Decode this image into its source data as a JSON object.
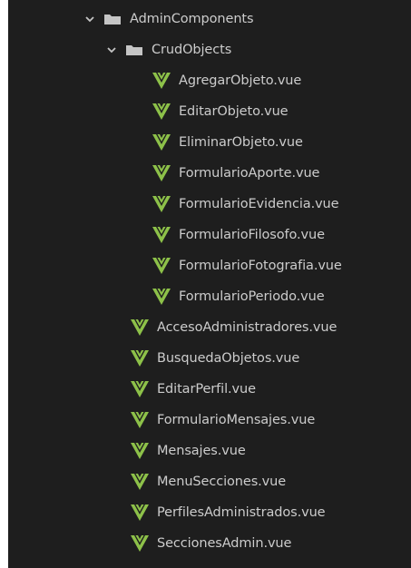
{
  "colors": {
    "background": "#1e1e1e",
    "text": "#cccccc",
    "folder": "#c5c5c5",
    "vue_logo": "#8dc149",
    "chevron": "#c5c5c5"
  },
  "tree": {
    "admin_components": {
      "label": "AdminComponents",
      "icon": "folder-icon",
      "expanded": true,
      "crud_objects": {
        "label": "CrudObjects",
        "icon": "folder-icon",
        "expanded": true,
        "files": [
          {
            "label": "AgregarObjeto.vue",
            "icon": "vue-icon"
          },
          {
            "label": "EditarObjeto.vue",
            "icon": "vue-icon"
          },
          {
            "label": "EliminarObjeto.vue",
            "icon": "vue-icon"
          },
          {
            "label": "FormularioAporte.vue",
            "icon": "vue-icon"
          },
          {
            "label": "FormularioEvidencia.vue",
            "icon": "vue-icon"
          },
          {
            "label": "FormularioFilosofo.vue",
            "icon": "vue-icon"
          },
          {
            "label": "FormularioFotografia.vue",
            "icon": "vue-icon"
          },
          {
            "label": "FormularioPeriodo.vue",
            "icon": "vue-icon"
          }
        ]
      },
      "files": [
        {
          "label": "AccesoAdministradores.vue",
          "icon": "vue-icon"
        },
        {
          "label": "BusquedaObjetos.vue",
          "icon": "vue-icon"
        },
        {
          "label": "EditarPerfil.vue",
          "icon": "vue-icon"
        },
        {
          "label": "FormularioMensajes.vue",
          "icon": "vue-icon"
        },
        {
          "label": "Mensajes.vue",
          "icon": "vue-icon"
        },
        {
          "label": "MenuSecciones.vue",
          "icon": "vue-icon"
        },
        {
          "label": "PerfilesAdministrados.vue",
          "icon": "vue-icon"
        },
        {
          "label": "SeccionesAdmin.vue",
          "icon": "vue-icon"
        }
      ]
    }
  }
}
